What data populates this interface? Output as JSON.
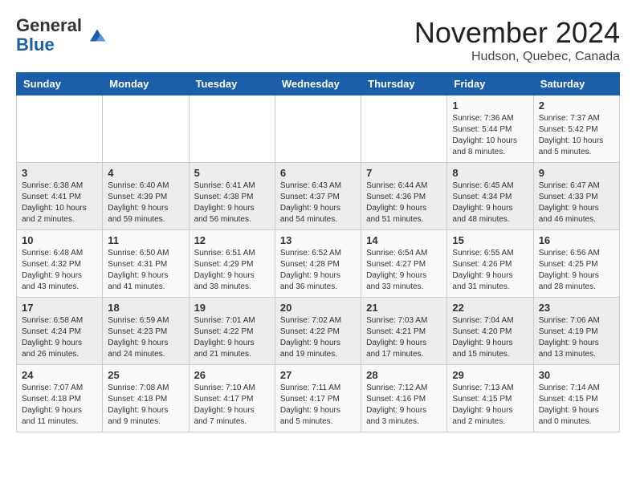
{
  "logo": {
    "line1": "General",
    "line2": "Blue"
  },
  "title": "November 2024",
  "subtitle": "Hudson, Quebec, Canada",
  "days_of_week": [
    "Sunday",
    "Monday",
    "Tuesday",
    "Wednesday",
    "Thursday",
    "Friday",
    "Saturday"
  ],
  "weeks": [
    [
      {
        "day": "",
        "info": ""
      },
      {
        "day": "",
        "info": ""
      },
      {
        "day": "",
        "info": ""
      },
      {
        "day": "",
        "info": ""
      },
      {
        "day": "",
        "info": ""
      },
      {
        "day": "1",
        "info": "Sunrise: 7:36 AM\nSunset: 5:44 PM\nDaylight: 10 hours and 8 minutes."
      },
      {
        "day": "2",
        "info": "Sunrise: 7:37 AM\nSunset: 5:42 PM\nDaylight: 10 hours and 5 minutes."
      }
    ],
    [
      {
        "day": "3",
        "info": "Sunrise: 6:38 AM\nSunset: 4:41 PM\nDaylight: 10 hours and 2 minutes."
      },
      {
        "day": "4",
        "info": "Sunrise: 6:40 AM\nSunset: 4:39 PM\nDaylight: 9 hours and 59 minutes."
      },
      {
        "day": "5",
        "info": "Sunrise: 6:41 AM\nSunset: 4:38 PM\nDaylight: 9 hours and 56 minutes."
      },
      {
        "day": "6",
        "info": "Sunrise: 6:43 AM\nSunset: 4:37 PM\nDaylight: 9 hours and 54 minutes."
      },
      {
        "day": "7",
        "info": "Sunrise: 6:44 AM\nSunset: 4:36 PM\nDaylight: 9 hours and 51 minutes."
      },
      {
        "day": "8",
        "info": "Sunrise: 6:45 AM\nSunset: 4:34 PM\nDaylight: 9 hours and 48 minutes."
      },
      {
        "day": "9",
        "info": "Sunrise: 6:47 AM\nSunset: 4:33 PM\nDaylight: 9 hours and 46 minutes."
      }
    ],
    [
      {
        "day": "10",
        "info": "Sunrise: 6:48 AM\nSunset: 4:32 PM\nDaylight: 9 hours and 43 minutes."
      },
      {
        "day": "11",
        "info": "Sunrise: 6:50 AM\nSunset: 4:31 PM\nDaylight: 9 hours and 41 minutes."
      },
      {
        "day": "12",
        "info": "Sunrise: 6:51 AM\nSunset: 4:29 PM\nDaylight: 9 hours and 38 minutes."
      },
      {
        "day": "13",
        "info": "Sunrise: 6:52 AM\nSunset: 4:28 PM\nDaylight: 9 hours and 36 minutes."
      },
      {
        "day": "14",
        "info": "Sunrise: 6:54 AM\nSunset: 4:27 PM\nDaylight: 9 hours and 33 minutes."
      },
      {
        "day": "15",
        "info": "Sunrise: 6:55 AM\nSunset: 4:26 PM\nDaylight: 9 hours and 31 minutes."
      },
      {
        "day": "16",
        "info": "Sunrise: 6:56 AM\nSunset: 4:25 PM\nDaylight: 9 hours and 28 minutes."
      }
    ],
    [
      {
        "day": "17",
        "info": "Sunrise: 6:58 AM\nSunset: 4:24 PM\nDaylight: 9 hours and 26 minutes."
      },
      {
        "day": "18",
        "info": "Sunrise: 6:59 AM\nSunset: 4:23 PM\nDaylight: 9 hours and 24 minutes."
      },
      {
        "day": "19",
        "info": "Sunrise: 7:01 AM\nSunset: 4:22 PM\nDaylight: 9 hours and 21 minutes."
      },
      {
        "day": "20",
        "info": "Sunrise: 7:02 AM\nSunset: 4:22 PM\nDaylight: 9 hours and 19 minutes."
      },
      {
        "day": "21",
        "info": "Sunrise: 7:03 AM\nSunset: 4:21 PM\nDaylight: 9 hours and 17 minutes."
      },
      {
        "day": "22",
        "info": "Sunrise: 7:04 AM\nSunset: 4:20 PM\nDaylight: 9 hours and 15 minutes."
      },
      {
        "day": "23",
        "info": "Sunrise: 7:06 AM\nSunset: 4:19 PM\nDaylight: 9 hours and 13 minutes."
      }
    ],
    [
      {
        "day": "24",
        "info": "Sunrise: 7:07 AM\nSunset: 4:18 PM\nDaylight: 9 hours and 11 minutes."
      },
      {
        "day": "25",
        "info": "Sunrise: 7:08 AM\nSunset: 4:18 PM\nDaylight: 9 hours and 9 minutes."
      },
      {
        "day": "26",
        "info": "Sunrise: 7:10 AM\nSunset: 4:17 PM\nDaylight: 9 hours and 7 minutes."
      },
      {
        "day": "27",
        "info": "Sunrise: 7:11 AM\nSunset: 4:17 PM\nDaylight: 9 hours and 5 minutes."
      },
      {
        "day": "28",
        "info": "Sunrise: 7:12 AM\nSunset: 4:16 PM\nDaylight: 9 hours and 3 minutes."
      },
      {
        "day": "29",
        "info": "Sunrise: 7:13 AM\nSunset: 4:15 PM\nDaylight: 9 hours and 2 minutes."
      },
      {
        "day": "30",
        "info": "Sunrise: 7:14 AM\nSunset: 4:15 PM\nDaylight: 9 hours and 0 minutes."
      }
    ]
  ]
}
